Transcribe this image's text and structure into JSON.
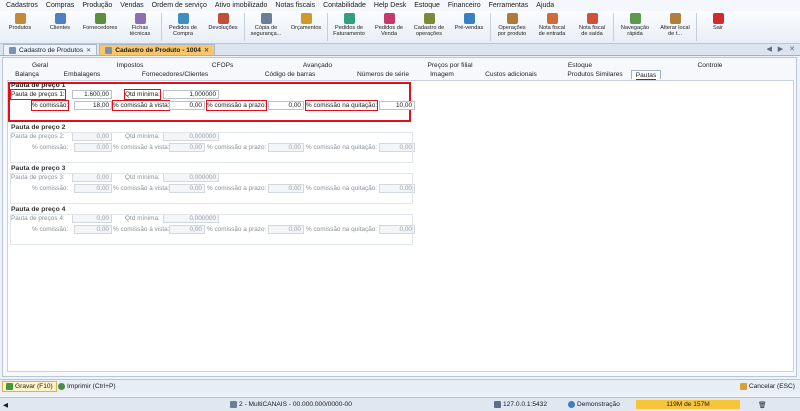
{
  "menu": [
    "Cadastros",
    "Compras",
    "Produção",
    "Vendas",
    "Ordem de serviço",
    "Ativo imobilizado",
    "Notas fiscais",
    "Contabilidade",
    "Help Desk",
    "Estoque",
    "Financeiro",
    "Ferramentas",
    "Ajuda"
  ],
  "toolbar": [
    {
      "label": "Produtos",
      "label2": "",
      "icon": "box-icon",
      "color": "#c48a3a"
    },
    {
      "label": "Clientes",
      "label2": "",
      "icon": "person-icon",
      "color": "#4f7fbf"
    },
    {
      "label": "Fornecedores",
      "label2": "",
      "icon": "supplier-icon",
      "color": "#5b8f3e"
    },
    {
      "label": "Fichas",
      "label2": "técnicas",
      "icon": "sheet-icon",
      "color": "#8c6fb0"
    },
    {
      "label": "Pedidos de",
      "label2": "Compra",
      "icon": "cart-icon",
      "color": "#3f8fbf"
    },
    {
      "label": "Devoluções",
      "label2": "",
      "icon": "return-icon",
      "color": "#c0503a"
    },
    {
      "label": "Cópia de",
      "label2": "segurança...",
      "icon": "backup-icon",
      "color": "#6a7f95"
    },
    {
      "label": "Orçamentos",
      "label2": "",
      "icon": "quote-icon",
      "color": "#d09a2a"
    },
    {
      "label": "Pedidos de",
      "label2": "Faturamento",
      "icon": "invoice-icon",
      "color": "#2f9f7f"
    },
    {
      "label": "Pedidos de",
      "label2": "Venda",
      "icon": "sale-icon",
      "color": "#c23a6a"
    },
    {
      "label": "Cadastro de",
      "label2": "operações",
      "icon": "operations-icon",
      "color": "#7a8a3a"
    },
    {
      "label": "Pré-vendas",
      "label2": "",
      "icon": "presale-icon",
      "color": "#3a7fc0"
    },
    {
      "label": "Operações",
      "label2": "por produto",
      "icon": "product-ops-icon",
      "color": "#b07a3a"
    },
    {
      "label": "Nota fiscal",
      "label2": "de entrada",
      "icon": "nf-in-icon",
      "color": "#d06a3a"
    },
    {
      "label": "Nota fiscal",
      "label2": "de saída",
      "icon": "nf-out-icon",
      "color": "#d0503a"
    },
    {
      "label": "Navegação",
      "label2": "rápida",
      "icon": "quick-nav-icon",
      "color": "#5a9a4a"
    },
    {
      "label": "Alterar local",
      "label2": "de t...",
      "icon": "home-icon",
      "color": "#b0803a"
    },
    {
      "label": "Sair",
      "label2": "",
      "icon": "exit-icon",
      "color": "#d02a2a"
    }
  ],
  "doc_tabs": [
    {
      "label": "Cadastro de Produtos",
      "active": false
    },
    {
      "label": "Cadastro de Produto - 1004",
      "active": true
    }
  ],
  "nav_arrows": "◀ ▶ ✕",
  "tabs_row1": [
    "Geral",
    "Impostos",
    "CFOPs",
    "Avançado",
    "Preços por filial",
    "Estoque",
    "Controle"
  ],
  "tabs_row2": [
    "Balança",
    "Embalagens",
    "Fornecedores/Clientes",
    "Código de barras",
    "Números de série",
    "Imagem",
    "Custos adicionais",
    "Produtos Similares",
    "Pautas"
  ],
  "pautas": [
    {
      "title": "Pauta de preço 1",
      "label_price": "Pauta de preços 1:",
      "price": "1.600,00",
      "label_qty": "Qtd mínima:",
      "qty": "1,000000",
      "label_comm": "% comissão:",
      "comm": "18,00",
      "label_comm_vista": "% comissão à vista:",
      "comm_vista": "0,00",
      "label_comm_prazo": "% comissão a prazo:",
      "comm_prazo": "0,00",
      "label_comm_quit": "% comissão na quitação:",
      "comm_quit": "10,00"
    },
    {
      "title": "Pauta de preço 2",
      "label_price": "Pauta de preços 2:",
      "price": "0,00",
      "label_qty": "Qtd mínima:",
      "qty": "0,000000",
      "label_comm": "% comissão:",
      "comm": "0,00",
      "label_comm_vista": "% comissão à vista:",
      "comm_vista": "0,00",
      "label_comm_prazo": "% comissão a prazo:",
      "comm_prazo": "0,00",
      "label_comm_quit": "% comissão na quitação:",
      "comm_quit": "0,00"
    },
    {
      "title": "Pauta de preço 3",
      "label_price": "Pauta de preços 3:",
      "price": "0,00",
      "label_qty": "Qtd mínima:",
      "qty": "0,000000",
      "label_comm": "% comissão:",
      "comm": "0,00",
      "label_comm_vista": "% comissão à vista:",
      "comm_vista": "0,00",
      "label_comm_prazo": "% comissão a prazo:",
      "comm_prazo": "0,00",
      "label_comm_quit": "% comissão na quitação:",
      "comm_quit": "0,00"
    },
    {
      "title": "Pauta de preço 4",
      "label_price": "Pauta de preços 4:",
      "price": "0,00",
      "label_qty": "Qtd mínima:",
      "qty": "0,000000",
      "label_comm": "% comissão:",
      "comm": "0,00",
      "label_comm_vista": "% comissão à vista:",
      "comm_vista": "0,00",
      "label_comm_prazo": "% comissão a prazo:",
      "comm_prazo": "0,00",
      "label_comm_quit": "% comissão na quitação:",
      "comm_quit": "0,00"
    }
  ],
  "actions": {
    "save": "Gravar (F10)",
    "print": "Imprimir (Ctrl+P)",
    "cancel": "Cancelar (ESC)"
  },
  "status": {
    "company": "2 - MultiCANAIS - 00.000.000/0000-00",
    "server": "127.0.0.1:5432",
    "user": "Demonstração",
    "memory": "119M de 157M"
  },
  "colors": {
    "highlight": "#e0101a",
    "active_tab": "#f7c76a",
    "memory_bar": "#f7c43a"
  }
}
